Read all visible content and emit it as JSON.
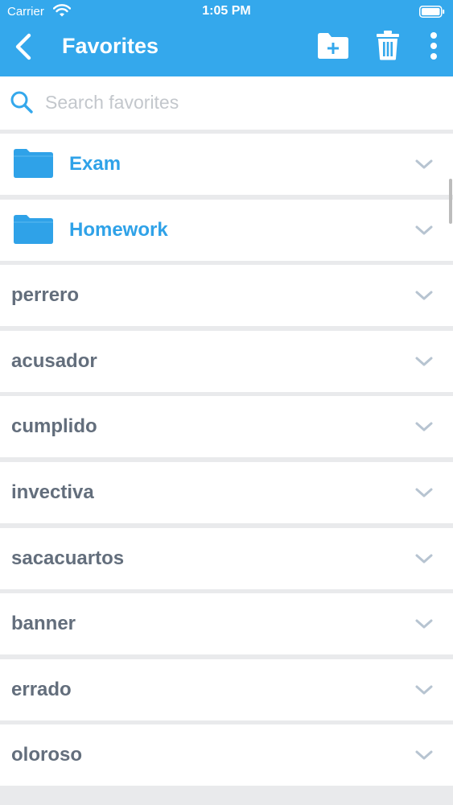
{
  "status_bar": {
    "carrier": "Carrier",
    "time": "1:05 PM"
  },
  "nav": {
    "title": "Favorites",
    "back_icon": "chevron-left-icon",
    "new_folder_icon": "folder-plus-icon",
    "delete_icon": "trash-icon",
    "more_icon": "more-vertical-icon"
  },
  "search": {
    "placeholder": "Search favorites",
    "value": ""
  },
  "folders": [
    {
      "label": "Exam"
    },
    {
      "label": "Homework"
    }
  ],
  "words": [
    {
      "label": "perrero"
    },
    {
      "label": "acusador"
    },
    {
      "label": "cumplido"
    },
    {
      "label": "invectiva"
    },
    {
      "label": "sacacuartos"
    },
    {
      "label": "banner"
    },
    {
      "label": "errado"
    },
    {
      "label": "oloroso"
    }
  ],
  "colors": {
    "header_background": "#34a8ec",
    "folder_accent": "#2fa2e8",
    "word_text": "#636e7c",
    "chevron": "#b7c4d1"
  }
}
